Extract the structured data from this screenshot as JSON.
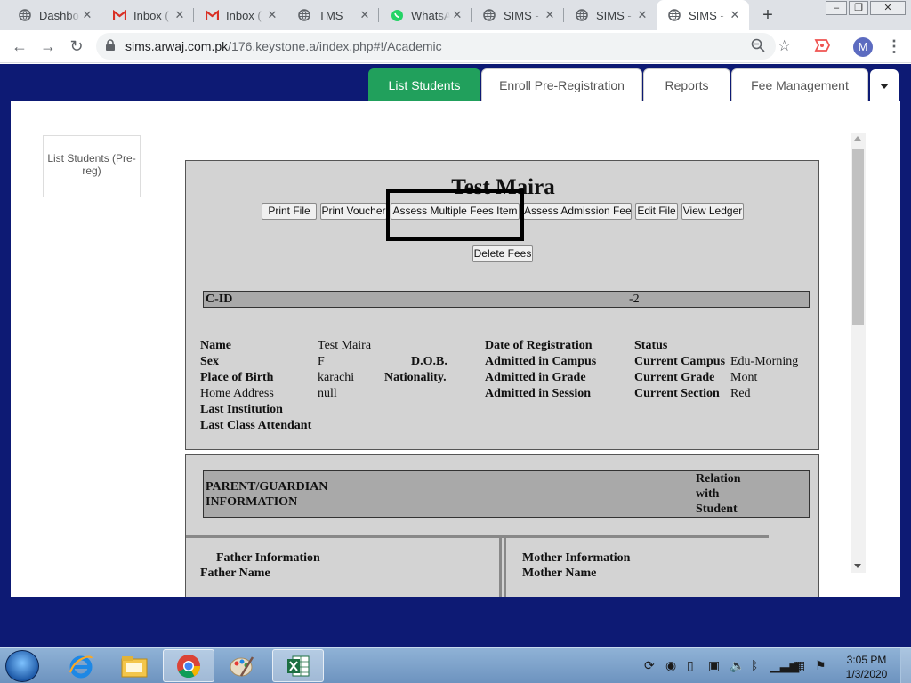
{
  "browser": {
    "tabs": [
      {
        "label": "Dashbo",
        "icon": "chrome-globe-icon"
      },
      {
        "label": "Inbox (",
        "icon": "gmail-icon"
      },
      {
        "label": "Inbox (",
        "icon": "gmail-icon"
      },
      {
        "label": "TMS",
        "icon": "chrome-globe-icon"
      },
      {
        "label": "WhatsA",
        "icon": "whatsapp-icon"
      },
      {
        "label": "SIMS - ",
        "icon": "chrome-globe-icon"
      },
      {
        "label": "SIMS - ",
        "icon": "chrome-globe-icon"
      },
      {
        "label": "SIMS - ",
        "icon": "chrome-globe-icon",
        "active": true
      }
    ],
    "url_host": "sims.arwaj.com.pk",
    "url_path": "/176.keystone.a/index.php#!/Academic",
    "avatar_letter": "M"
  },
  "app": {
    "tabs": [
      "List Students",
      "Enroll Pre-Registration",
      "Reports",
      "Fee Management"
    ],
    "active_tab": "List Students",
    "sidebar_button": "List Students (Pre-reg)",
    "colors": {
      "active_tab": "#21a05c",
      "page_background": "#0d1a74",
      "card": "#d3d3d3"
    }
  },
  "student": {
    "name": "Test Maira",
    "actions": [
      "Print File",
      "Print Voucher",
      "Assess Multiple Fees Item",
      "Assess Admission Fee",
      "Edit File",
      "View Ledger"
    ],
    "delete_label": "Delete Fees",
    "cid_label": "C-ID",
    "cid_value": "-2",
    "fields": {
      "name_label": "Name",
      "name_value": "Test Maira",
      "sex_label": "Sex",
      "sex_value": "F",
      "dob_label": "D.O.B.",
      "birth_label": "Place of Birth",
      "birth_value": "karachi",
      "nationality_label": "Nationality.",
      "address_label": "Home Address",
      "address_value": "null",
      "last_institution_label": "Last Institution",
      "last_class_label": "Last Class Attendant",
      "reg_date_label": "Date of Registration",
      "adm_campus_label": "Admitted in Campus",
      "adm_grade_label": "Admitted in Grade",
      "adm_session_label": "Admitted in Session",
      "status_label": "Status",
      "cur_campus_label": "Current Campus",
      "cur_campus_value": "Edu-Morning",
      "cur_grade_label": "Current Grade",
      "cur_grade_value": "Mont",
      "cur_section_label": "Current Section",
      "cur_section_value": "Red"
    }
  },
  "parent": {
    "title_line1": "PARENT/GUARDIAN",
    "title_line2": "INFORMATION",
    "relation_line1": "Relation",
    "relation_line2": "with",
    "relation_line3": "Student",
    "father_title": "Father Information",
    "father_name_label": "Father Name",
    "mother_title": "Mother Information",
    "mother_name_label": "Mother Name"
  },
  "taskbar": {
    "time": "3:05 PM",
    "date": "1/3/2020",
    "apps": [
      "internet-explorer-icon",
      "file-explorer-icon",
      "chrome-icon",
      "paint-icon",
      "excel-icon"
    ]
  }
}
